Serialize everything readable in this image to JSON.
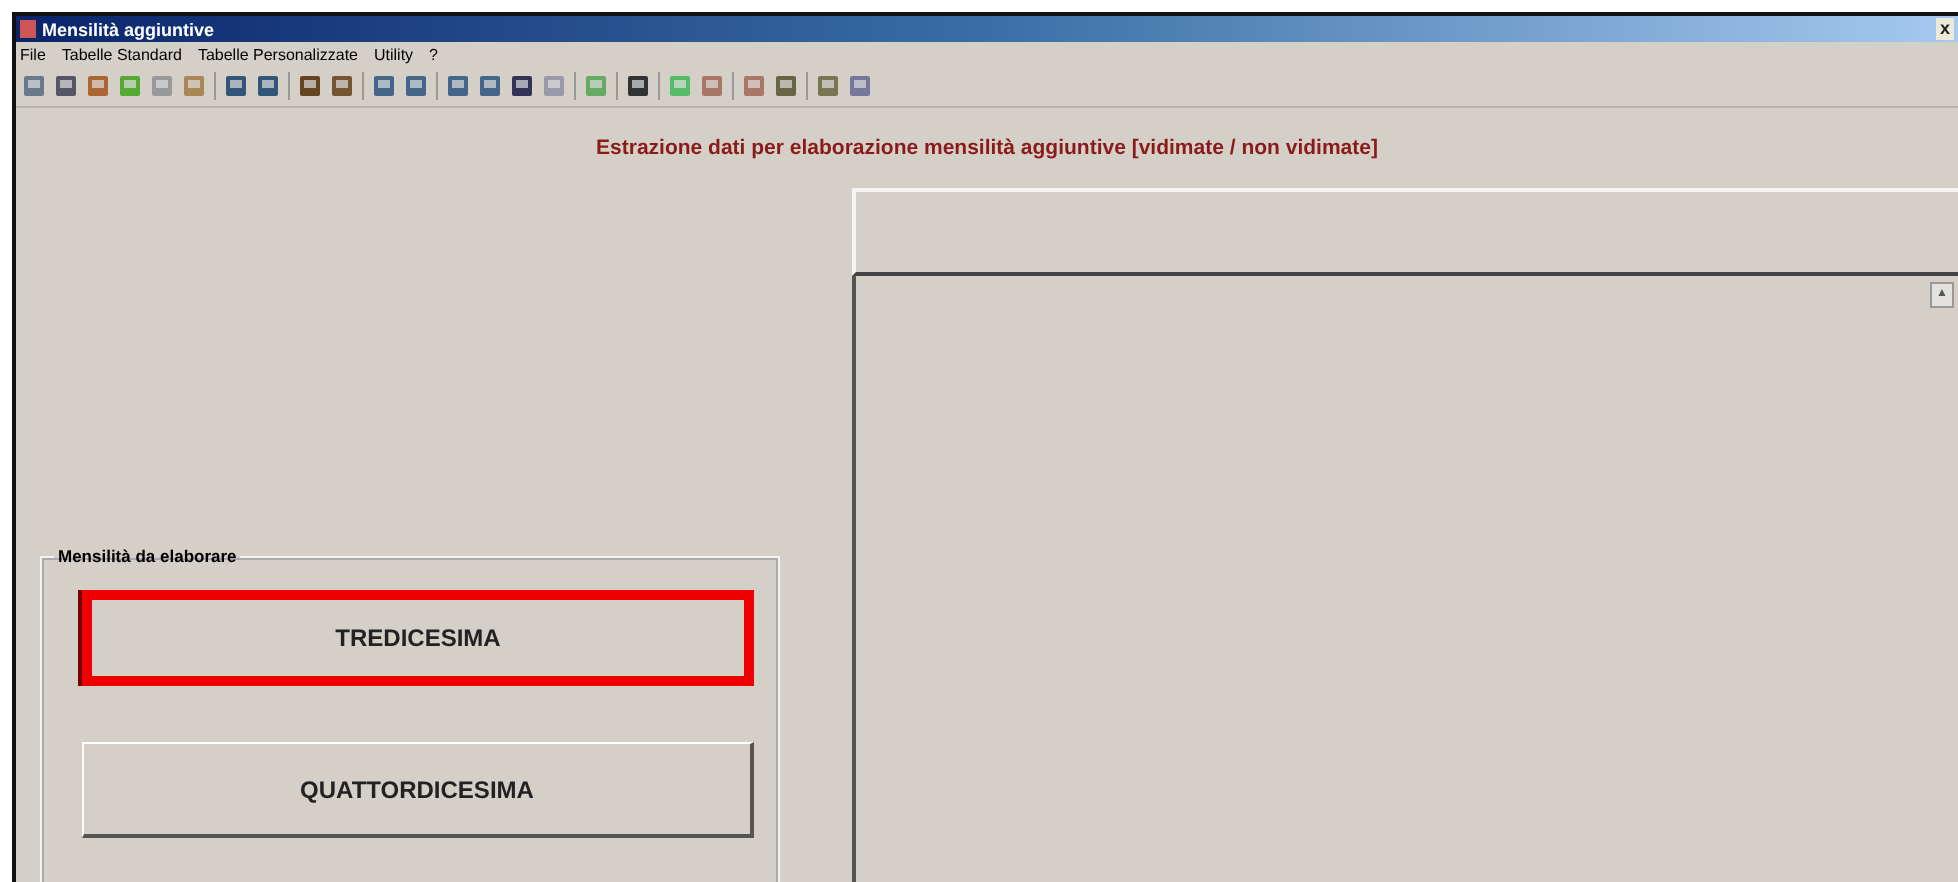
{
  "window": {
    "title": "Mensilità aggiuntive",
    "close": "x"
  },
  "menu": [
    "File",
    "Tabelle Standard",
    "Tabelle Personalizzate",
    "Utility",
    "?"
  ],
  "heading": "Estrazione dati per elaborazione mensilità aggiuntive [vidimate / non vidimate]",
  "group": {
    "title": "Mensilità da elaborare",
    "buttons": [
      {
        "label": "TREDICESIMA",
        "selected": true
      },
      {
        "label": "QUATTORDICESIMA",
        "selected": false
      }
    ]
  },
  "list": {
    "scroll_up": "▲"
  }
}
